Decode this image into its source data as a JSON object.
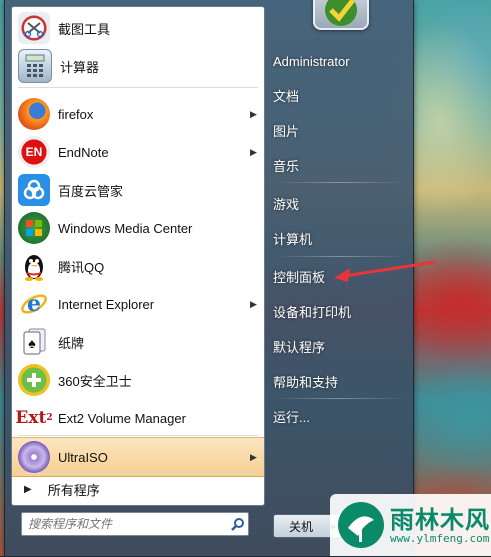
{
  "programs": [
    {
      "label": "截图工具",
      "icon": "scissors-icon",
      "has_submenu": false
    },
    {
      "label": "计算器",
      "icon": "calculator-icon",
      "has_submenu": false
    },
    {
      "label": "firefox",
      "icon": "firefox-icon",
      "has_submenu": true
    },
    {
      "label": "EndNote",
      "icon": "endnote-icon",
      "has_submenu": true
    },
    {
      "label": "百度云管家",
      "icon": "baidu-cloud-icon",
      "has_submenu": false
    },
    {
      "label": "Windows Media Center",
      "icon": "windows-media-center-icon",
      "has_submenu": false
    },
    {
      "label": "腾讯QQ",
      "icon": "qq-penguin-icon",
      "has_submenu": false
    },
    {
      "label": "Internet Explorer",
      "icon": "internet-explorer-icon",
      "has_submenu": true
    },
    {
      "label": "纸牌",
      "icon": "solitaire-icon",
      "has_submenu": false
    },
    {
      "label": "360安全卫士",
      "icon": "360-security-icon",
      "has_submenu": false
    },
    {
      "label": "Ext2 Volume Manager",
      "icon": "ext2-icon",
      "has_submenu": false
    },
    {
      "label": "UltraISO",
      "icon": "ultraiso-disc-icon",
      "has_submenu": true,
      "highlighted": true
    }
  ],
  "all_programs_label": "所有程序",
  "search": {
    "placeholder": "搜索程序和文件"
  },
  "right_panel": [
    {
      "label": "Administrator"
    },
    {
      "label": "文档"
    },
    {
      "label": "图片"
    },
    {
      "label": "音乐"
    },
    {
      "label": "游戏"
    },
    {
      "label": "计算机"
    },
    {
      "label": "控制面板"
    },
    {
      "label": "设备和打印机"
    },
    {
      "label": "默认程序"
    },
    {
      "label": "帮助和支持"
    },
    {
      "label": "运行..."
    }
  ],
  "shutdown_label": "关机",
  "watermark": {
    "title": "雨林木风",
    "url": "www.ylmfeng.com"
  },
  "colors": {
    "highlight": "#f7cf8e",
    "annotation_arrow": "#e8353a",
    "watermark": "#0b8a6a"
  }
}
